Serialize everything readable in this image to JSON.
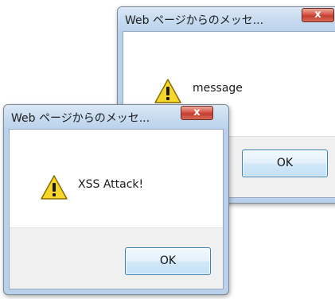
{
  "dialogs": [
    {
      "title": "Web ページからのメッセ...",
      "close_label": "x",
      "icon": "warning-icon",
      "message": "message",
      "ok_label": "OK"
    },
    {
      "title": "Web ページからのメッセ...",
      "close_label": "x",
      "icon": "warning-icon",
      "message": "XSS Attack!",
      "ok_label": "OK"
    }
  ],
  "colors": {
    "titlebar": "#c7dbf0",
    "close_button": "#c43e2f",
    "footer": "#f0f0f0",
    "ok_border": "#3c7fb1",
    "warning_fill": "#f7d62a"
  }
}
